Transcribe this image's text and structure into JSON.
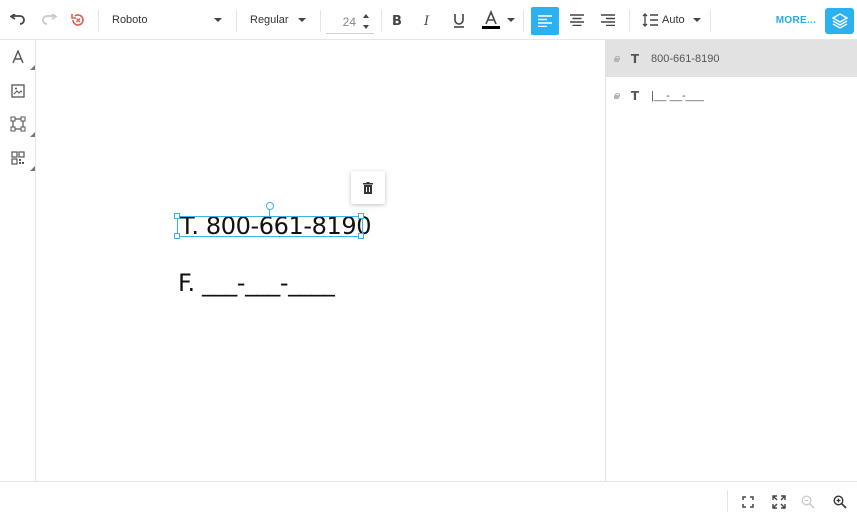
{
  "toolbar": {
    "font_family": "Roboto",
    "font_weight": "Regular",
    "font_size": "24",
    "line_height": "Auto",
    "more_label": "MORE...",
    "text_color": "#000000",
    "accent_color": "#2cb1f0",
    "icons": [
      "undo-icon",
      "redo-icon",
      "reset-icon",
      "bold-icon",
      "italic-icon",
      "underline-icon",
      "text-color-icon",
      "align-left-icon",
      "align-center-icon",
      "align-right-icon",
      "line-height-icon",
      "layers-icon"
    ]
  },
  "left_tools": [
    "text-tool-icon",
    "image-tool-icon",
    "shape-tool-icon",
    "qr-code-tool-icon"
  ],
  "canvas": {
    "texts": [
      "T. 800-661-8190",
      "F. ___-___-____"
    ]
  },
  "layers": [
    {
      "name": "800-661-8190",
      "type": "text",
      "selected": true
    },
    {
      "name": "|__-__-___",
      "type": "text",
      "selected": false
    }
  ],
  "bottom_tools": [
    "fit-screen-icon",
    "fullscreen-icon",
    "zoom-out-icon",
    "zoom-in-icon"
  ]
}
